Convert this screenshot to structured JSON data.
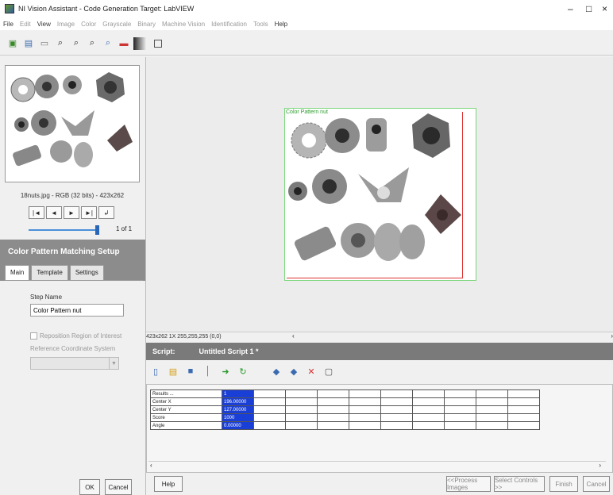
{
  "window": {
    "title": "NI Vision Assistant - Code Generation Target: LabVIEW",
    "controls": [
      "–",
      "□",
      "×"
    ]
  },
  "menu": [
    {
      "label": "File",
      "enabled": true
    },
    {
      "label": "Edit",
      "enabled": false
    },
    {
      "label": "View",
      "enabled": true
    },
    {
      "label": "Image",
      "enabled": false
    },
    {
      "label": "Color",
      "enabled": false
    },
    {
      "label": "Grayscale",
      "enabled": false
    },
    {
      "label": "Binary",
      "enabled": false
    },
    {
      "label": "Machine Vision",
      "enabled": false
    },
    {
      "label": "Identification",
      "enabled": false
    },
    {
      "label": "Tools",
      "enabled": false
    },
    {
      "label": "Help",
      "enabled": true
    }
  ],
  "browser": {
    "image_caption": "18nuts.jpg - RGB (32 bits) - 423x262",
    "page_indicator": "1 of 1",
    "nav_buttons": [
      "|◄",
      "◄",
      "►",
      "►|",
      "↲"
    ]
  },
  "step_panel": {
    "title": "Color Pattern Matching Setup",
    "tabs": [
      "Main",
      "Template",
      "Settings"
    ],
    "step_name_label": "Step Name",
    "step_name_value": "Color Pattern nut",
    "reposition_roi_label": "Reposition Region of Interest",
    "ref_coord_label": "Reference Coordinate System",
    "ok_label": "OK",
    "cancel_label": "Cancel"
  },
  "canvas": {
    "roi_label": "Color Pattern nut",
    "status_text": "423x262 1X 255,255,255 (0,0)"
  },
  "script": {
    "label": "Script:",
    "name": "Untitled Script 1 *"
  },
  "results": {
    "column_header": "1",
    "rows": [
      {
        "label": "Results ...",
        "value": "1"
      },
      {
        "label": "Center X",
        "value": "196.00000"
      },
      {
        "label": "Center Y",
        "value": "127.00000"
      },
      {
        "label": "Score",
        "value": "1000"
      },
      {
        "label": "Angle",
        "value": "0.00000"
      }
    ]
  },
  "footer": {
    "help_label": "Help",
    "process_images_label": "<<Process Images",
    "select_controls_label": "Select Controls >>",
    "finish_label": "Finish",
    "cancel_label": "Cancel"
  },
  "colors": {
    "step_header_bg": "#8c8c8c",
    "script_header_bg": "#7a7a7a",
    "result_highlight": "#1a3fd6",
    "roi_outer": "#7bd77b",
    "roi_inner": "#dd3333"
  }
}
